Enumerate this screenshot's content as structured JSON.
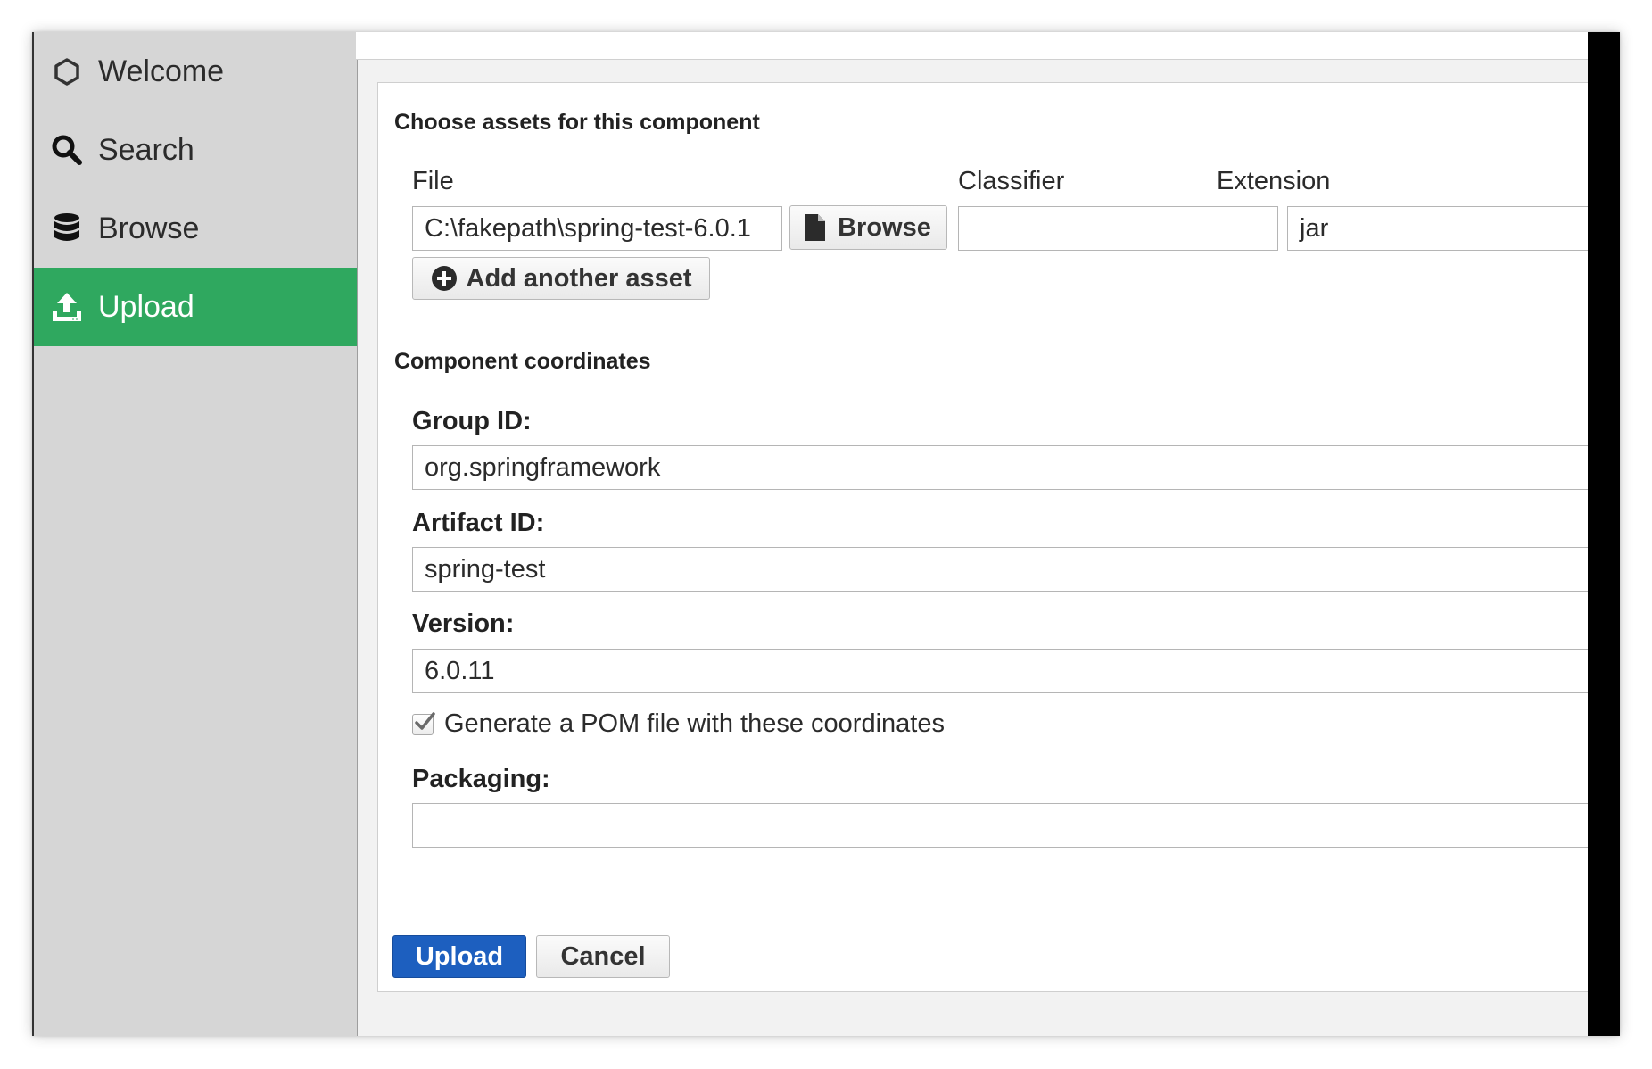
{
  "sidebar": {
    "items": [
      {
        "label": "Welcome",
        "icon": "hexagon-icon"
      },
      {
        "label": "Search",
        "icon": "search-icon"
      },
      {
        "label": "Browse",
        "icon": "database-icon"
      },
      {
        "label": "Upload",
        "icon": "upload-icon",
        "active": true
      }
    ],
    "active_color": "#2fa85f"
  },
  "assets": {
    "title": "Choose assets for this component",
    "columns": {
      "file": "File",
      "classifier": "Classifier",
      "extension": "Extension"
    },
    "file_value": "C:\\fakepath\\spring-test-6.0.1",
    "browse_label": "Browse",
    "classifier_value": "",
    "extension_value": "jar",
    "add_asset_label": "Add another asset"
  },
  "coordinates": {
    "title": "Component coordinates",
    "group_id_label": "Group ID:",
    "group_id_value": "org.springframework",
    "artifact_id_label": "Artifact ID:",
    "artifact_id_value": "spring-test",
    "version_label": "Version:",
    "version_value": "6.0.11",
    "generate_pom_label": "Generate a POM file with these coordinates",
    "generate_pom_checked": true,
    "packaging_label": "Packaging:",
    "packaging_value": ""
  },
  "actions": {
    "upload_label": "Upload",
    "cancel_label": "Cancel",
    "primary_color": "#1d5fbf"
  }
}
